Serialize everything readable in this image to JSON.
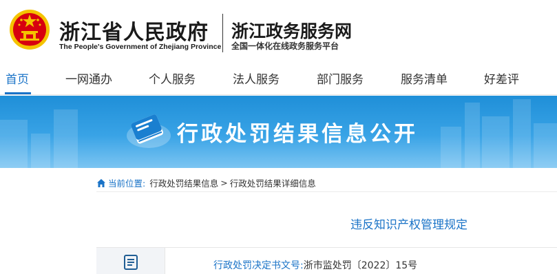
{
  "header": {
    "gov_name": "浙江省人民政府",
    "gov_name_en": "The People's Government of Zhejiang Province",
    "service_name": "浙江政务服务网",
    "service_tagline": "全国一体化在线政务服务平台",
    "emblem_icon": "national-emblem-icon"
  },
  "nav": {
    "items": [
      {
        "label": "首页",
        "active": true
      },
      {
        "label": "一网通办"
      },
      {
        "label": "个人服务"
      },
      {
        "label": "法人服务"
      },
      {
        "label": "部门服务"
      },
      {
        "label": "服务清单"
      },
      {
        "label": "好差评"
      }
    ]
  },
  "banner": {
    "title": "行政处罚结果信息公开",
    "icon": "book-icon"
  },
  "breadcrumb": {
    "label": "当前位置:",
    "level1": "行政处罚结果信息",
    "separator": ">",
    "level2": "行政处罚结果详细信息"
  },
  "document": {
    "title": "违反知识产权管理规定",
    "doc_number_label": "行政处罚决定书文号:",
    "doc_number_value": "浙市监处罚〔2022〕15号"
  },
  "colors": {
    "accent": "#1a73c7",
    "banner_top": "#1f8fd8",
    "banner_bottom": "#7cc5f2",
    "emblem_red": "#d7000f",
    "emblem_gold": "#f4c300"
  }
}
